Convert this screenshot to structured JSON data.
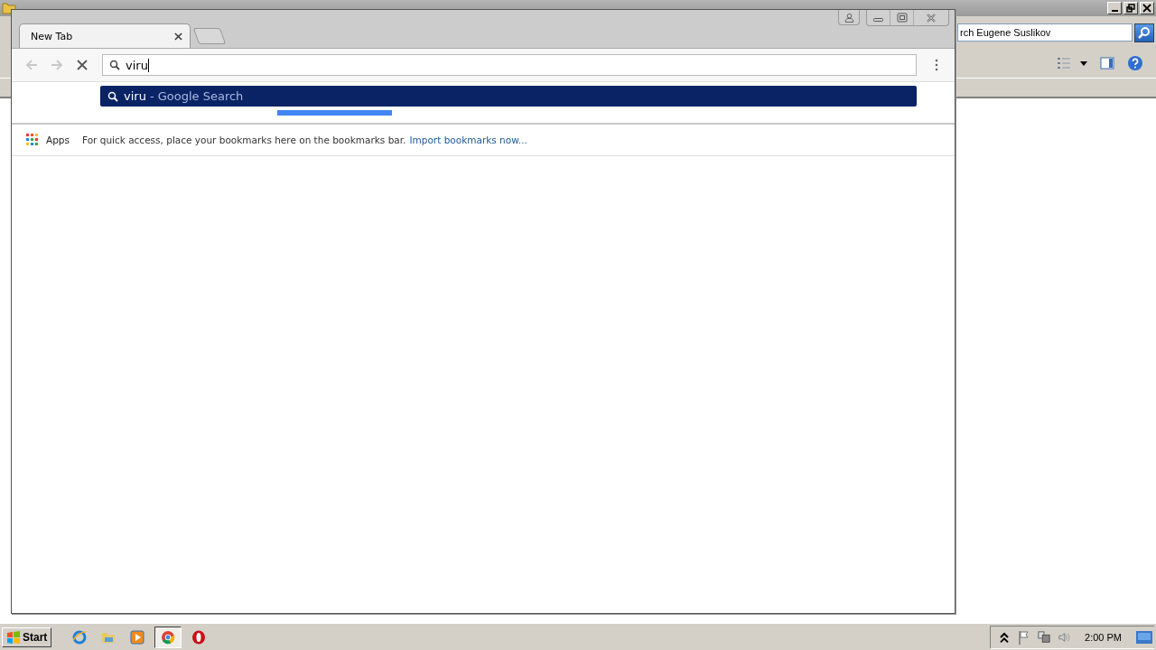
{
  "background_window": {
    "search": {
      "value": "rch Eugene Suslikov"
    }
  },
  "browser": {
    "tabs": [
      {
        "label": "New Tab",
        "selected": true
      }
    ],
    "address": {
      "value": "viru"
    },
    "suggestions": [
      {
        "query": "viru",
        "description": "- Google Search",
        "selected": true
      }
    ],
    "bookmarks_bar": {
      "apps_label": "Apps",
      "message": "For quick access, place your bookmarks here on the bookmarks bar.",
      "link": "Import bookmarks now..."
    }
  },
  "taskbar": {
    "start_label": "Start",
    "apps": [
      {
        "kind": "ie",
        "selected": false
      },
      {
        "kind": "folder",
        "selected": false
      },
      {
        "kind": "media",
        "selected": false
      },
      {
        "kind": "chrome",
        "selected": true
      },
      {
        "kind": "opera",
        "selected": false
      }
    ],
    "clock": "2:00 PM"
  }
}
